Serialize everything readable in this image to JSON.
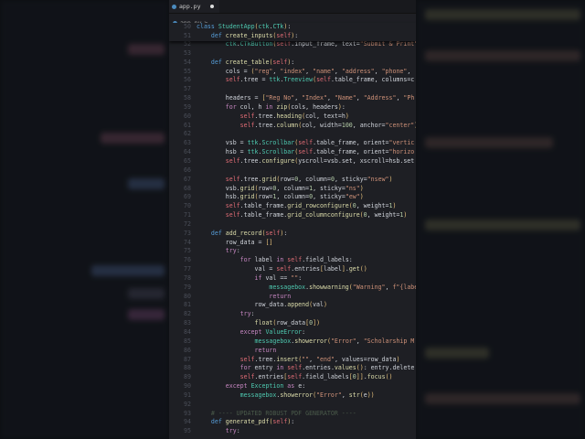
{
  "tab": {
    "label": "app.py"
  },
  "breadcrumb": {
    "file": "app.py",
    "sep": ">",
    "more": "..."
  },
  "code": {
    "sticky": [
      {
        "num": "50",
        "text": "class StudentApp(ctk.CTk):"
      },
      {
        "num": "51",
        "text": "    def create_inputs(self):"
      }
    ],
    "lines": [
      {
        "num": "52",
        "text": "        ctk.CTkButton(self.input_frame, text=\"Submit & Print\", c"
      },
      {
        "num": "53",
        "text": ""
      },
      {
        "num": "54",
        "text": "    def create_table(self):"
      },
      {
        "num": "55",
        "text": "        cols = (\"reg\", \"index\", \"name\", \"address\", \"phone\", "
      },
      {
        "num": "56",
        "text": "        self.tree = ttk.Treeview(self.table_frame, columns=c"
      },
      {
        "num": "57",
        "text": ""
      },
      {
        "num": "58",
        "text": "        headers = [\"Reg No\", \"Index\", \"Name\", \"Address\", \"Ph"
      },
      {
        "num": "59",
        "text": "        for col, h in zip(cols, headers):"
      },
      {
        "num": "60",
        "text": "            self.tree.heading(col, text=h)"
      },
      {
        "num": "61",
        "text": "            self.tree.column(col, width=100, anchor=\"center\")"
      },
      {
        "num": "62",
        "text": ""
      },
      {
        "num": "63",
        "text": "        vsb = ttk.Scrollbar(self.table_frame, orient=\"vertic"
      },
      {
        "num": "64",
        "text": "        hsb = ttk.Scrollbar(self.table_frame, orient=\"horizo"
      },
      {
        "num": "65",
        "text": "        self.tree.configure(yscroll=vsb.set, xscroll=hsb.set"
      },
      {
        "num": "66",
        "text": ""
      },
      {
        "num": "67",
        "text": "        self.tree.grid(row=0, column=0, sticky=\"nsew\")"
      },
      {
        "num": "68",
        "text": "        vsb.grid(row=0, column=1, sticky=\"ns\")"
      },
      {
        "num": "69",
        "text": "        hsb.grid(row=1, column=0, sticky=\"ew\")"
      },
      {
        "num": "70",
        "text": "        self.table_frame.grid_rowconfigure(0, weight=1)"
      },
      {
        "num": "71",
        "text": "        self.table_frame.grid_columnconfigure(0, weight=1)"
      },
      {
        "num": "72",
        "text": ""
      },
      {
        "num": "73",
        "text": "    def add_record(self):"
      },
      {
        "num": "74",
        "text": "        row_data = []"
      },
      {
        "num": "75",
        "text": "        try:"
      },
      {
        "num": "76",
        "text": "            for label in self.field_labels:"
      },
      {
        "num": "77",
        "text": "                val = self.entries[label].get()"
      },
      {
        "num": "78",
        "text": "                if val == \"\":"
      },
      {
        "num": "79",
        "text": "                    messagebox.showwarning(\"Warning\", f\"{label"
      },
      {
        "num": "80",
        "text": "                    return"
      },
      {
        "num": "81",
        "text": "                row_data.append(val)"
      },
      {
        "num": "82",
        "text": "            try:"
      },
      {
        "num": "83",
        "text": "                float(row_data[0])"
      },
      {
        "num": "84",
        "text": "            except ValueError:"
      },
      {
        "num": "85",
        "text": "                messagebox.showerror(\"Error\", \"Scholarship M"
      },
      {
        "num": "86",
        "text": "                return"
      },
      {
        "num": "87",
        "text": "            self.tree.insert(\"\", \"end\", values=row_data)"
      },
      {
        "num": "88",
        "text": "            for entry in self.entries.values(): entry.delete"
      },
      {
        "num": "89",
        "text": "            self.entries[self.field_labels[0]].focus()"
      },
      {
        "num": "90",
        "text": "        except Exception as e:"
      },
      {
        "num": "91",
        "text": "            messagebox.showerror(\"Error\", str(e))"
      },
      {
        "num": "92",
        "text": ""
      },
      {
        "num": "93",
        "text": "    # ---- UPDATED ROBUST PDF GENERATOR ----"
      },
      {
        "num": "94",
        "text": "    def generate_pdf(self):"
      },
      {
        "num": "95",
        "text": "        try:"
      }
    ]
  },
  "colors": {
    "editor_bg": "#1e1f24",
    "keyword": "#569cd6",
    "control": "#c586c0",
    "string": "#ce9178",
    "function": "#dcdcaa"
  }
}
